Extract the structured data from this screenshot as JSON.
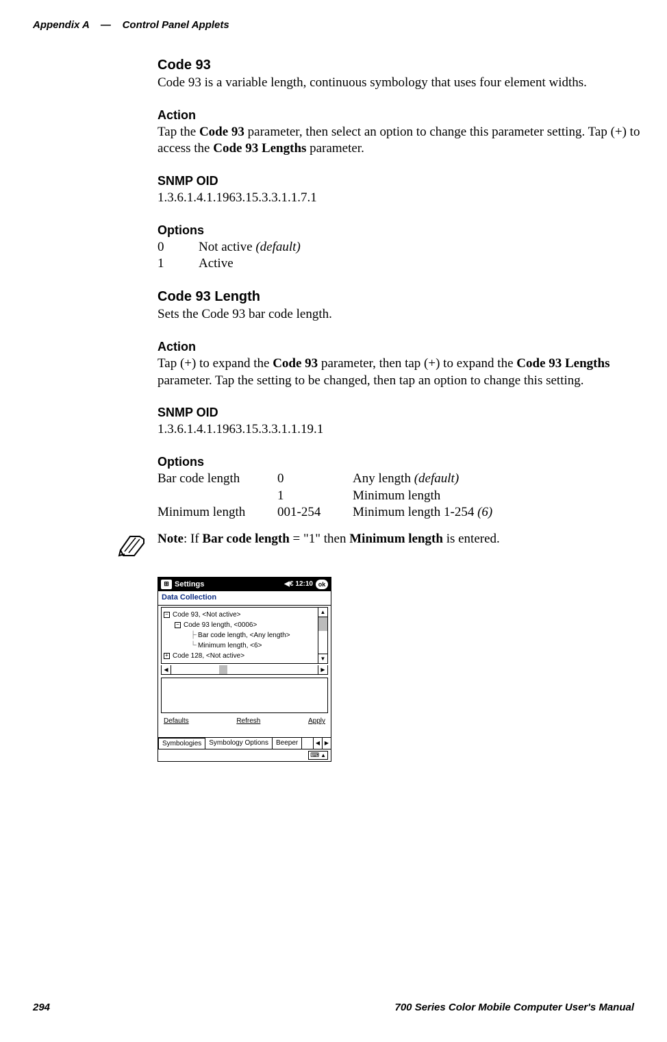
{
  "header": {
    "left_app": "Appendix  A",
    "sep": "—",
    "left_title": "Control Panel Applets"
  },
  "sec_code93": {
    "title": "Code 93",
    "desc": "Code 93 is a variable length, continuous symbology that uses four element widths."
  },
  "sec_action1": {
    "title": "Action",
    "pre": "Tap the ",
    "b1": "Code 93",
    "mid": " parameter, then select an option to change this parameter setting. Tap (+) to access the ",
    "b2": "Code 93 Lengths",
    "post": " parameter."
  },
  "sec_snmp1": {
    "title": "SNMP OID",
    "value": "1.3.6.1.4.1.1963.15.3.3.1.1.7.1"
  },
  "sec_options1": {
    "title": "Options",
    "rows": [
      {
        "k": "0",
        "v_pre": "Not active ",
        "v_it": "(default)"
      },
      {
        "k": "1",
        "v_pre": "Active",
        "v_it": ""
      }
    ]
  },
  "sec_c93len": {
    "title": "Code 93 Length",
    "desc": "Sets the Code 93 bar code length."
  },
  "sec_action2": {
    "title": "Action",
    "pre": "Tap (+) to expand the ",
    "b1": "Code 93",
    "mid1": " parameter, then tap (+) to expand the ",
    "b2": "Code 93 Lengths",
    "mid2": " parameter. Tap the setting to be changed, then tap an option to change this setting."
  },
  "sec_snmp2": {
    "title": "SNMP OID",
    "value": "1.3.6.1.4.1.1963.15.3.3.1.1.19.1"
  },
  "sec_options2": {
    "title": "Options",
    "r1": {
      "a": "Bar code length",
      "b": "0",
      "c_pre": "Any length ",
      "c_it": "(default)"
    },
    "r2": {
      "a": "",
      "b": "1",
      "c_pre": "Minimum length",
      "c_it": ""
    },
    "r3": {
      "a": "Minimum length",
      "b": "001-254",
      "c_pre": "Minimum length 1-254 ",
      "c_it": "(6)"
    }
  },
  "note": {
    "pre": "Note",
    "mid1": ": If ",
    "b1": "Bar code length",
    "mid2": " = \"1\" then ",
    "b2": "Minimum length",
    "post": " is entered."
  },
  "device": {
    "title": "Settings",
    "time": "12:10",
    "ok": "ok",
    "app_title": "Data Collection",
    "tree": {
      "r1": "Code 93, <Not active>",
      "r2": "Code 93 length, <0006>",
      "r3": "Bar code length, <Any length>",
      "r4": "Minimum length, <6>",
      "r5": "Code 128, <Not active>"
    },
    "buttons": {
      "defaults": "Defaults",
      "refresh": "Refresh",
      "apply": "Apply"
    },
    "tabs": {
      "t1": "Symbologies",
      "t2": "Symbology Options",
      "t3": "Beeper"
    }
  },
  "footer": {
    "page": "294",
    "title": "700 Series Color Mobile Computer User's Manual"
  }
}
